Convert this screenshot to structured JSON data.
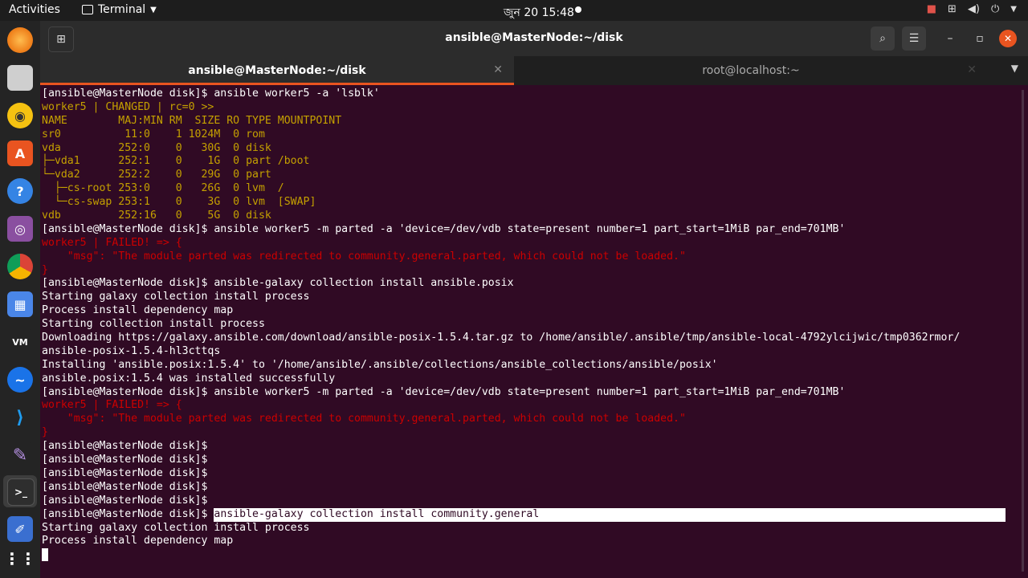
{
  "topbar": {
    "activities": "Activities",
    "app_name": "Terminal",
    "clock": "জুন 20  15:48"
  },
  "window": {
    "title": "ansible@MasterNode:~/disk",
    "tabs": [
      {
        "label": "ansible@MasterNode:~/disk",
        "active": true
      },
      {
        "label": "root@localhost:~",
        "active": false
      }
    ]
  },
  "colors": {
    "terminal_bg": "#300a24",
    "changed": "#c4a000",
    "failed": "#cc0000",
    "accent": "#e95420"
  },
  "dock": [
    "firefox-icon",
    "files-icon",
    "rhythmbox-icon",
    "software-center-icon",
    "help-icon",
    "screenshot-icon",
    "chrome-icon",
    "drawing-icon",
    "vmware-icon",
    "thunderbird-icon",
    "vscode-icon",
    "feather-icon",
    "terminal-icon",
    "text-editor-icon",
    "show-apps-icon"
  ],
  "terminal": {
    "lines": [
      {
        "t": "[ansible@MasterNode disk]$ ansible worker5 -a 'lsblk'",
        "c": ""
      },
      {
        "t": "worker5 | CHANGED | rc=0 >>",
        "c": "y"
      },
      {
        "t": "NAME        MAJ:MIN RM  SIZE RO TYPE MOUNTPOINT",
        "c": "y"
      },
      {
        "t": "sr0          11:0    1 1024M  0 rom",
        "c": "y"
      },
      {
        "t": "vda         252:0    0   30G  0 disk",
        "c": "y"
      },
      {
        "t": "├─vda1      252:1    0    1G  0 part /boot",
        "c": "y"
      },
      {
        "t": "└─vda2      252:2    0   29G  0 part",
        "c": "y"
      },
      {
        "t": "  ├─cs-root 253:0    0   26G  0 lvm  /",
        "c": "y"
      },
      {
        "t": "  └─cs-swap 253:1    0    3G  0 lvm  [SWAP]",
        "c": "y"
      },
      {
        "t": "vdb         252:16   0    5G  0 disk",
        "c": "y"
      },
      {
        "t": "[ansible@MasterNode disk]$ ansible worker5 -m parted -a 'device=/dev/vdb state=present number=1 part_start=1MiB par_end=701MB'",
        "c": ""
      },
      {
        "t": "worker5 | FAILED! => {",
        "c": "r"
      },
      {
        "t": "    \"msg\": \"The module parted was redirected to community.general.parted, which could not be loaded.\"",
        "c": "r"
      },
      {
        "t": "}",
        "c": "r"
      },
      {
        "t": "[ansible@MasterNode disk]$ ansible-galaxy collection install ansible.posix",
        "c": ""
      },
      {
        "t": "Starting galaxy collection install process",
        "c": ""
      },
      {
        "t": "Process install dependency map",
        "c": ""
      },
      {
        "t": "Starting collection install process",
        "c": ""
      },
      {
        "t": "Downloading https://galaxy.ansible.com/download/ansible-posix-1.5.4.tar.gz to /home/ansible/.ansible/tmp/ansible-local-4792ylcijwic/tmp0362rmor/",
        "c": ""
      },
      {
        "t": "ansible-posix-1.5.4-hl3cttqs",
        "c": ""
      },
      {
        "t": "Installing 'ansible.posix:1.5.4' to '/home/ansible/.ansible/collections/ansible_collections/ansible/posix'",
        "c": ""
      },
      {
        "t": "ansible.posix:1.5.4 was installed successfully",
        "c": ""
      },
      {
        "t": "[ansible@MasterNode disk]$ ansible worker5 -m parted -a 'device=/dev/vdb state=present number=1 part_start=1MiB par_end=701MB'",
        "c": ""
      },
      {
        "t": "worker5 | FAILED! => {",
        "c": "r"
      },
      {
        "t": "    \"msg\": \"The module parted was redirected to community.general.parted, which could not be loaded.\"",
        "c": "r"
      },
      {
        "t": "}",
        "c": "r"
      },
      {
        "t": "[ansible@MasterNode disk]$",
        "c": ""
      },
      {
        "t": "[ansible@MasterNode disk]$",
        "c": ""
      },
      {
        "t": "[ansible@MasterNode disk]$",
        "c": ""
      },
      {
        "t": "[ansible@MasterNode disk]$",
        "c": ""
      },
      {
        "t": "[ansible@MasterNode disk]$",
        "c": ""
      }
    ],
    "highlight_prompt": "[ansible@MasterNode disk]$ ",
    "highlight_cmd": "ansible-galaxy collection install community.general",
    "tail": [
      "Starting galaxy collection install process",
      "Process install dependency map"
    ]
  }
}
